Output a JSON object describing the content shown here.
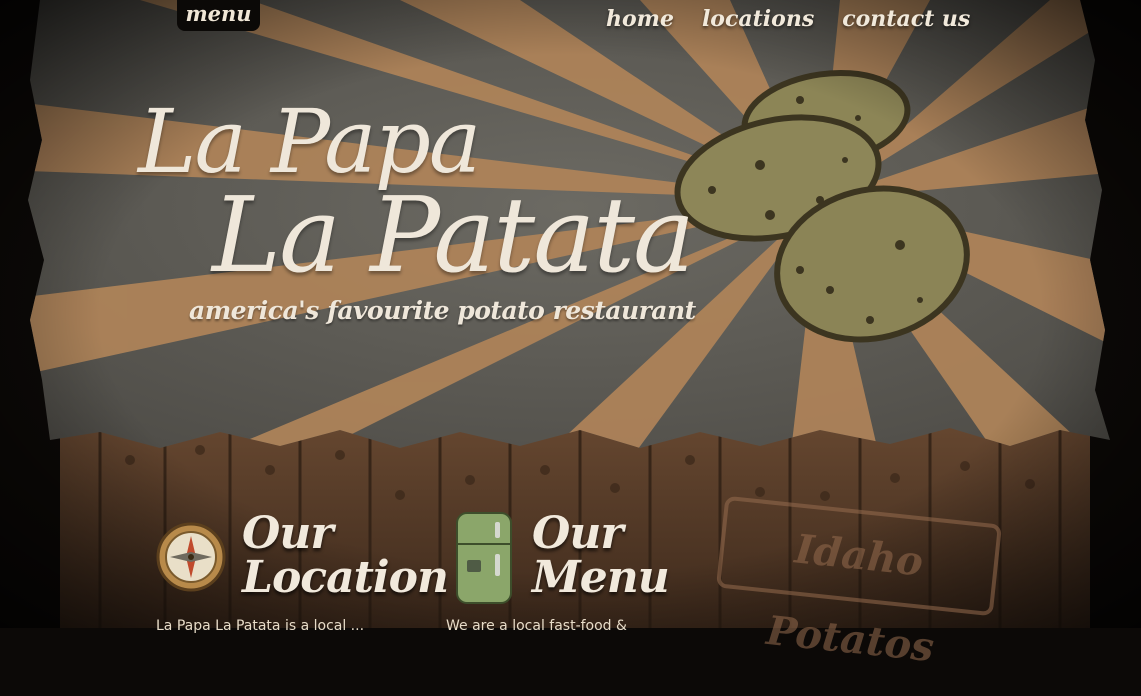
{
  "menu_tab": {
    "label": "menu"
  },
  "nav": {
    "items": [
      "home",
      "locations",
      "contact us"
    ]
  },
  "hero": {
    "title_line1": "La Papa",
    "title_line2": "La Patata",
    "tagline": "america's favourite potato restaurant"
  },
  "sections": [
    {
      "title_line1": "Our",
      "title_line2": "Location",
      "icon": "compass-icon",
      "text": "La Papa La Patata is a local ..."
    },
    {
      "title_line1": "Our",
      "title_line2": "Menu",
      "icon": "fridge-icon",
      "text": "We are a local fast-food &"
    }
  ],
  "stamp": {
    "text": "Idaho Potatos"
  },
  "colors": {
    "cream": "#efe7da",
    "sky_gray": "#65635d",
    "ray_orange": "#b3865c",
    "wood": "#5a3c27",
    "potato": "#8d8658"
  }
}
